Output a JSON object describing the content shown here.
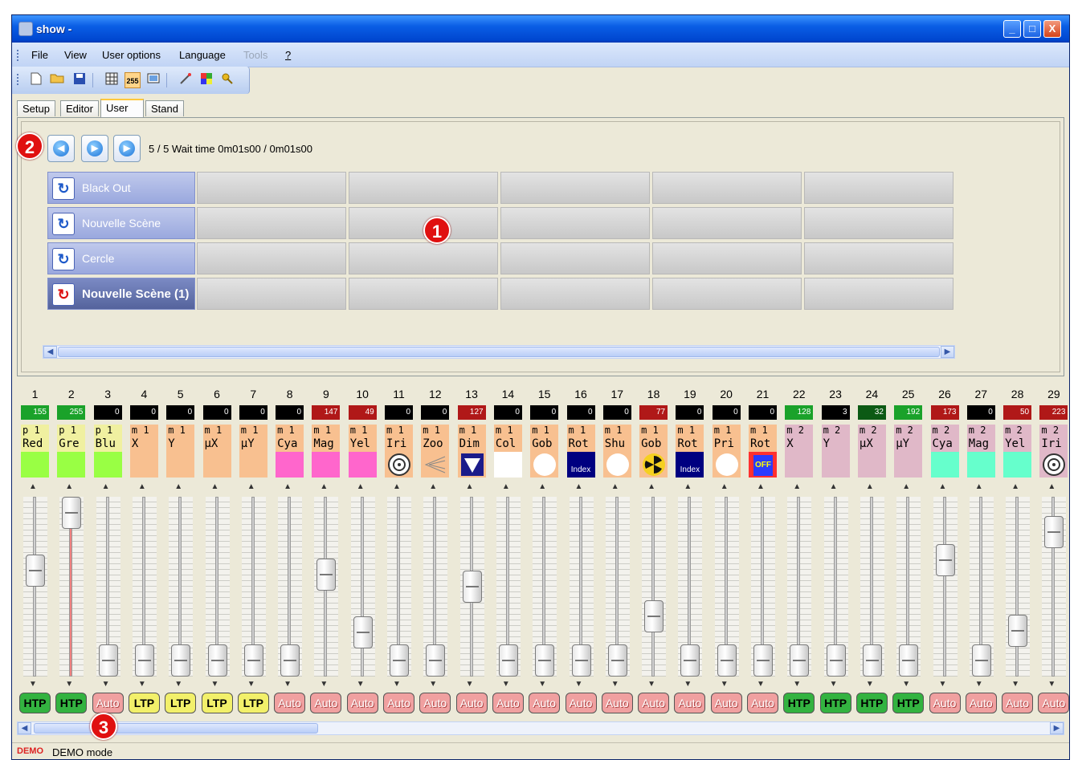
{
  "window": {
    "title": "show -",
    "minimize": "_",
    "maximize": "□",
    "close": "X"
  },
  "menu": [
    {
      "label": "File",
      "enabled": true
    },
    {
      "label": "View",
      "enabled": true
    },
    {
      "label": "User options",
      "enabled": true
    },
    {
      "label": "Language",
      "enabled": true
    },
    {
      "label": "Tools",
      "enabled": false
    },
    {
      "label": "?",
      "enabled": true
    }
  ],
  "toolbar": {
    "icons": [
      "new-icon",
      "open-folder-icon",
      "save-icon",
      "grid-icon",
      "value-255-icon",
      "monitor-icon",
      "wand-icon",
      "palette-icon",
      "key-icon"
    ],
    "value_255_label": "255"
  },
  "tabs": [
    "Setup",
    "Editor",
    "User",
    "Stand Alone"
  ],
  "active_tab": "User",
  "player": {
    "status": "5 / 5  Wait time 0m01s00 / 0m01s00"
  },
  "scenes": [
    {
      "label": "Black Out",
      "active": false
    },
    {
      "label": "Nouvelle Scène",
      "active": false
    },
    {
      "label": "Cercle",
      "active": false
    },
    {
      "label": "Nouvelle Scène (1)",
      "active": true
    }
  ],
  "callouts": [
    "1",
    "2",
    "3"
  ],
  "status": {
    "demo_logo": "DEMO",
    "text": "DEMO mode"
  },
  "colors": {
    "htp": "#33b340",
    "ltp": "#f2f06a",
    "auto": "#f0a0a0",
    "green_val": "#1aa22a",
    "red_val": "#b01818"
  },
  "channels": [
    {
      "num": "1",
      "value": "155",
      "val_color": "green",
      "l1": "p 1",
      "l2": "Red",
      "bg": "#f0f0a0",
      "sw": "#99ff44",
      "icon": "",
      "mode": "HTP",
      "level": 0.61
    },
    {
      "num": "2",
      "value": "255",
      "val_color": "green",
      "l1": "p 1",
      "l2": "Gre",
      "bg": "#f0f0a0",
      "sw": "#99ff44",
      "icon": "",
      "mode": "HTP",
      "level": 1.0
    },
    {
      "num": "3",
      "value": "0",
      "val_color": "black",
      "l1": "p 1",
      "l2": "Blu",
      "bg": "#f0f0a0",
      "sw": "#99ff44",
      "icon": "",
      "mode": "Auto",
      "level": 0
    },
    {
      "num": "4",
      "value": "0",
      "val_color": "black",
      "l1": "m 1",
      "l2": "X",
      "bg": "#f8c090",
      "sw": "#f8c090",
      "icon": "",
      "mode": "LTP",
      "level": 0
    },
    {
      "num": "5",
      "value": "0",
      "val_color": "black",
      "l1": "m 1",
      "l2": "Y",
      "bg": "#f8c090",
      "sw": "#f8c090",
      "icon": "",
      "mode": "LTP",
      "level": 0
    },
    {
      "num": "6",
      "value": "0",
      "val_color": "black",
      "l1": "m 1",
      "l2": "µX",
      "bg": "#f8c090",
      "sw": "#f8c090",
      "icon": "",
      "mode": "LTP",
      "level": 0
    },
    {
      "num": "7",
      "value": "0",
      "val_color": "black",
      "l1": "m 1",
      "l2": "µY",
      "bg": "#f8c090",
      "sw": "#f8c090",
      "icon": "",
      "mode": "LTP",
      "level": 0
    },
    {
      "num": "8",
      "value": "0",
      "val_color": "black",
      "l1": "m 1",
      "l2": "Cya",
      "bg": "#f8c090",
      "sw": "#ff66cc",
      "icon": "",
      "mode": "Auto",
      "level": 0
    },
    {
      "num": "9",
      "value": "147",
      "val_color": "red",
      "l1": "m 1",
      "l2": "Mag",
      "bg": "#f8c090",
      "sw": "#ff66cc",
      "icon": "",
      "mode": "Auto",
      "level": 0.58
    },
    {
      "num": "10",
      "value": "49",
      "val_color": "red",
      "l1": "m 1",
      "l2": "Yel",
      "bg": "#f8c090",
      "sw": "#ff66cc",
      "icon": "",
      "mode": "Auto",
      "level": 0.19
    },
    {
      "num": "11",
      "value": "0",
      "val_color": "black",
      "l1": "m 1",
      "l2": "Iri",
      "bg": "#f8c090",
      "sw": "#f8c090",
      "icon": "iris",
      "mode": "Auto",
      "level": 0
    },
    {
      "num": "12",
      "value": "0",
      "val_color": "black",
      "l1": "m 1",
      "l2": "Zoo",
      "bg": "#f8c090",
      "sw": "#f8c090",
      "icon": "zoom",
      "mode": "Auto",
      "level": 0
    },
    {
      "num": "13",
      "value": "127",
      "val_color": "red",
      "l1": "m 1",
      "l2": "Dim",
      "bg": "#f8c090",
      "sw": "#f8c090",
      "icon": "dimmer",
      "mode": "Auto",
      "level": 0.5
    },
    {
      "num": "14",
      "value": "0",
      "val_color": "black",
      "l1": "m 1",
      "l2": "Col",
      "bg": "#f8c090",
      "sw": "#ffffff",
      "icon": "",
      "mode": "Auto",
      "level": 0
    },
    {
      "num": "15",
      "value": "0",
      "val_color": "black",
      "l1": "m 1",
      "l2": "Gob",
      "bg": "#f8c090",
      "sw": "#f8c090",
      "icon": "white",
      "mode": "Auto",
      "level": 0
    },
    {
      "num": "16",
      "value": "0",
      "val_color": "black",
      "l1": "m 1",
      "l2": "Rot",
      "bg": "#f8c090",
      "sw": "#000080",
      "icon": "index",
      "mode": "Auto",
      "level": 0
    },
    {
      "num": "17",
      "value": "0",
      "val_color": "black",
      "l1": "m 1",
      "l2": "Shu",
      "bg": "#f8c090",
      "sw": "#f8c090",
      "icon": "white",
      "mode": "Auto",
      "level": 0
    },
    {
      "num": "18",
      "value": "77",
      "val_color": "red",
      "l1": "m 1",
      "l2": "Gob",
      "bg": "#f8c090",
      "sw": "#f8c090",
      "icon": "gobo",
      "mode": "Auto",
      "level": 0.3
    },
    {
      "num": "19",
      "value": "0",
      "val_color": "black",
      "l1": "m 1",
      "l2": "Rot",
      "bg": "#f8c090",
      "sw": "#000080",
      "icon": "index",
      "mode": "Auto",
      "level": 0
    },
    {
      "num": "20",
      "value": "0",
      "val_color": "black",
      "l1": "m 1",
      "l2": "Pri",
      "bg": "#f8c090",
      "sw": "#f8c090",
      "icon": "white",
      "mode": "Auto",
      "level": 0
    },
    {
      "num": "21",
      "value": "0",
      "val_color": "black",
      "l1": "m 1",
      "l2": "Rot",
      "bg": "#f8c090",
      "sw": "#ff3030",
      "icon": "off",
      "mode": "Auto",
      "level": 0
    },
    {
      "num": "22",
      "value": "128",
      "val_color": "green",
      "l1": "m 2",
      "l2": "X",
      "bg": "#e0b8c8",
      "sw": "#e0b8c8",
      "icon": "",
      "mode": "HTP",
      "level": 0
    },
    {
      "num": "23",
      "value": "3",
      "val_color": "black",
      "l1": "m 2",
      "l2": "Y",
      "bg": "#e0b8c8",
      "sw": "#e0b8c8",
      "icon": "",
      "mode": "HTP",
      "level": 0
    },
    {
      "num": "24",
      "value": "32",
      "val_color": "darkgreen",
      "l1": "m 2",
      "l2": "µX",
      "bg": "#e0b8c8",
      "sw": "#e0b8c8",
      "icon": "",
      "mode": "HTP",
      "level": 0
    },
    {
      "num": "25",
      "value": "192",
      "val_color": "green",
      "l1": "m 2",
      "l2": "µY",
      "bg": "#e0b8c8",
      "sw": "#e0b8c8",
      "icon": "",
      "mode": "HTP",
      "level": 0
    },
    {
      "num": "26",
      "value": "173",
      "val_color": "red",
      "l1": "m 2",
      "l2": "Cya",
      "bg": "#e0b8c8",
      "sw": "#66ffcc",
      "icon": "",
      "mode": "Auto",
      "level": 0.68
    },
    {
      "num": "27",
      "value": "0",
      "val_color": "black",
      "l1": "m 2",
      "l2": "Mag",
      "bg": "#e0b8c8",
      "sw": "#66ffcc",
      "icon": "",
      "mode": "Auto",
      "level": 0
    },
    {
      "num": "28",
      "value": "50",
      "val_color": "red",
      "l1": "m 2",
      "l2": "Yel",
      "bg": "#e0b8c8",
      "sw": "#66ffcc",
      "icon": "",
      "mode": "Auto",
      "level": 0.2
    },
    {
      "num": "29",
      "value": "223",
      "val_color": "red",
      "l1": "m 2",
      "l2": "Iri",
      "bg": "#e0b8c8",
      "sw": "#e0b8c8",
      "icon": "iris",
      "mode": "Auto",
      "level": 0.87
    }
  ]
}
